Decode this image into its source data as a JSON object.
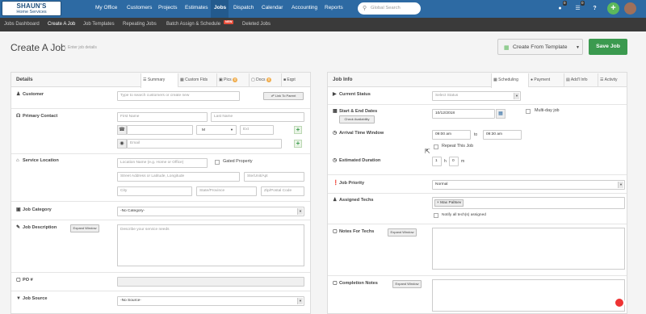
{
  "brand": {
    "line1": "SHAUN'S",
    "line2": "Home Services"
  },
  "topnav": {
    "items": [
      "My Office",
      "Customers",
      "Projects",
      "Estimates",
      "Jobs",
      "Dispatch",
      "Calendar",
      "Accounting",
      "Reports"
    ],
    "search_placeholder": "Global Search",
    "badges": [
      "0",
      "0"
    ]
  },
  "subnav": {
    "items": [
      "Jobs Dashboard",
      "Create A Job",
      "Job Templates",
      "Repeating Jobs",
      "Batch Assign & Schedule",
      "Deleted Jobs"
    ],
    "new_badge": "NEW"
  },
  "header": {
    "title": "Create A Job",
    "subtitle": "Enter job details",
    "template_button": "Create From Template",
    "save_button": "Save Job"
  },
  "details": {
    "title": "Details",
    "tabs": [
      "Summary",
      "Custom Flds",
      "Pics",
      "Docs",
      "Eqpt"
    ],
    "tab_badges": [
      "0",
      "0"
    ],
    "customer_label": "Customer",
    "customer_placeholder": "Type to search customers or create new",
    "link_parent": "Link To Parent",
    "primary_contact_label": "Primary Contact",
    "first_name": "First Name",
    "last_name": "Last Name",
    "phone_type": "M",
    "ext": "Ext",
    "email": "Email",
    "service_location_label": "Service Location",
    "location_name": "Location Name (e.g. Home or Office)",
    "gated_property": "Gated Property",
    "street": "Street Address or Latitude, Longitude",
    "unit": "Ste/Unit/Apt",
    "city": "City",
    "state": "State/Province",
    "zip": "Zip/Postal Code",
    "job_category_label": "Job Category",
    "job_category_value": "-No Category-",
    "job_description_label": "Job Description",
    "expand_window": "Expand Window",
    "description_placeholder": "Describe your service needs",
    "po_label": "PO #",
    "job_source_label": "Job Source",
    "job_source_value": "-No Source-"
  },
  "jobinfo": {
    "title": "Job Info",
    "tabs": [
      "Scheduling",
      "Payment",
      "Add'l Info",
      "Activity"
    ],
    "current_status_label": "Current Status",
    "status_placeholder": "Select Status",
    "start_end_label": "Start & End Dates",
    "check_availability": "Check Availability",
    "date_value": "10/12/2018",
    "multi_day": "Multi-day job",
    "arrival_window_label": "Arrival Time Window",
    "arrival_from": "09:00 am",
    "to": "to",
    "arrival_to": "09:30 am",
    "repeat_job": "Repeat This Job",
    "estimated_duration_label": "Estimated Duration",
    "duration_hours": "1",
    "h": "h",
    "duration_minutes": "0",
    "m": "m",
    "job_priority_label": "Job Priority",
    "priority_value": "Normal",
    "assigned_techs_label": "Assigned Techs",
    "tech_tag": "Max Paltsev",
    "notify_techs": "Notify all tech(s) assigned",
    "notes_techs_label": "Notes For Techs",
    "completion_notes_label": "Completion Notes",
    "expand_window": "Expand Window"
  },
  "colors": {
    "nav_blue": "#2d6aa3",
    "save_green": "#3b9a4f",
    "subnav": "#3a3a3a"
  }
}
